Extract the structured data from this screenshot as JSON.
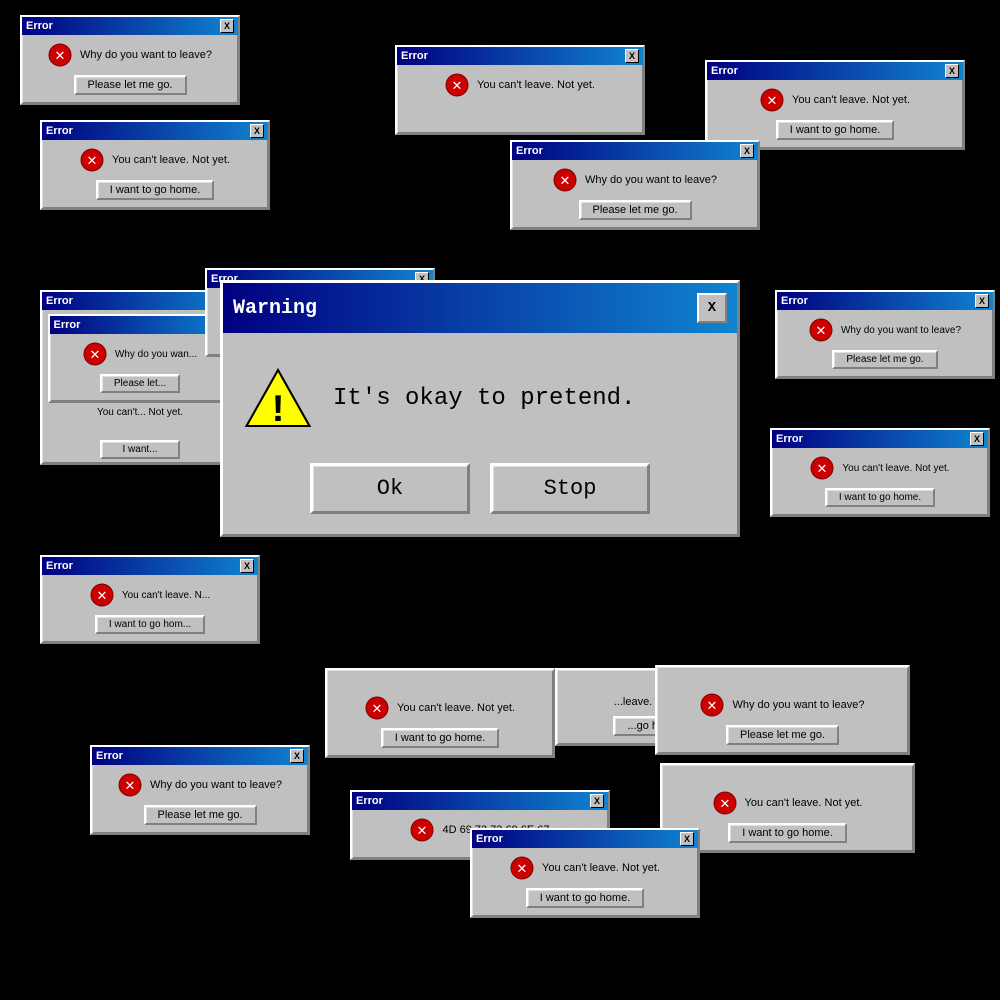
{
  "dialogs": {
    "error_title": "Error",
    "warning_title": "Warning",
    "messages": {
      "why_leave": "Why do you want to leave?",
      "cant_leave": "You can't leave. Not yet.",
      "pretend": "It's okay to pretend.",
      "missing": "4D 69 73 73 69 6E 67"
    },
    "buttons": {
      "please_let": "Please let me go.",
      "i_want": "I want to go home.",
      "i_want_short": "I want to go hom",
      "ok": "Ok",
      "stop": "Stop",
      "close": "✕",
      "close_x": "X"
    }
  }
}
